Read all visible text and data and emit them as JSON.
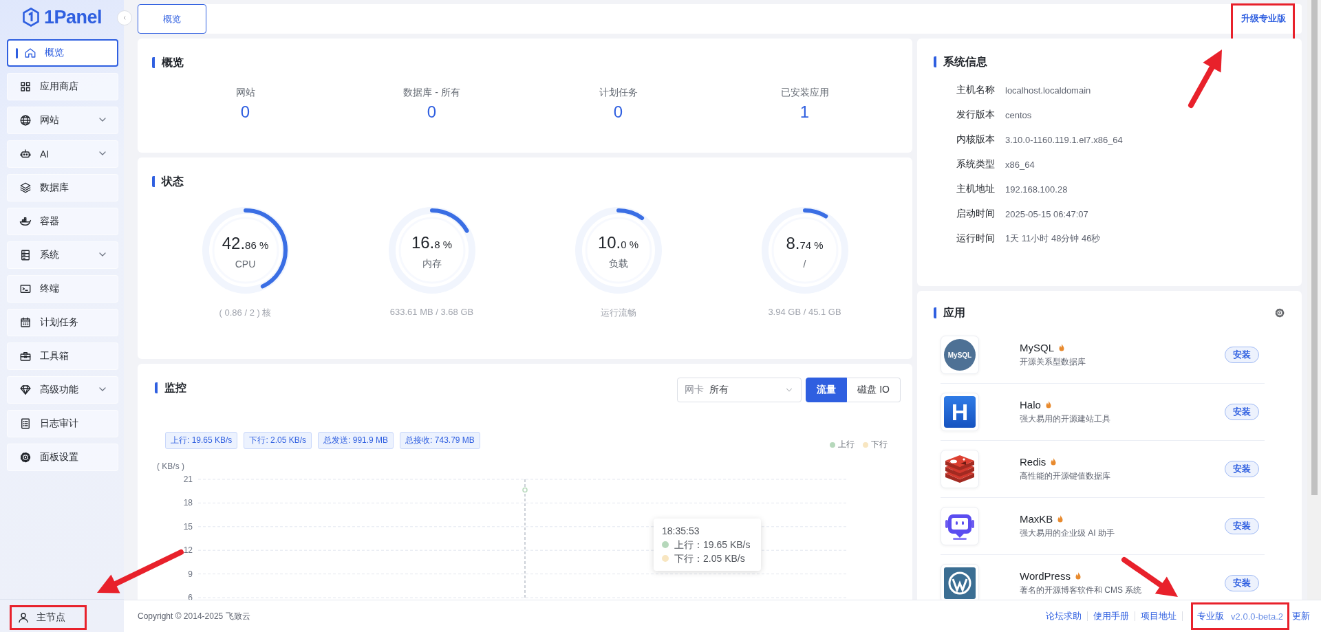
{
  "sidebar": {
    "logo": "1Panel",
    "items": [
      {
        "label": "概览",
        "kind": "item",
        "selected": true
      },
      {
        "label": "应用商店",
        "kind": "item",
        "selected": false
      },
      {
        "label": "网站",
        "kind": "menu",
        "selected": false
      },
      {
        "label": "AI",
        "kind": "menu",
        "selected": false
      },
      {
        "label": "数据库",
        "kind": "item",
        "selected": false
      },
      {
        "label": "容器",
        "kind": "item",
        "selected": false
      },
      {
        "label": "系统",
        "kind": "menu",
        "selected": false
      },
      {
        "label": "终端",
        "kind": "item",
        "selected": false
      },
      {
        "label": "计划任务",
        "kind": "item",
        "selected": false
      },
      {
        "label": "工具箱",
        "kind": "item",
        "selected": false
      },
      {
        "label": "高级功能",
        "kind": "menu",
        "selected": false
      },
      {
        "label": "日志审计",
        "kind": "item",
        "selected": false
      },
      {
        "label": "面板设置",
        "kind": "item",
        "selected": false
      }
    ],
    "node": "主节点"
  },
  "topbar": {
    "tabs": [
      {
        "label": "概览",
        "selected": true
      }
    ],
    "upgrade": "升级专业版"
  },
  "overview": {
    "title": "概览",
    "stats": [
      {
        "label": "网站",
        "value": "0"
      },
      {
        "label": "数据库 - 所有",
        "value": "0"
      },
      {
        "label": "计划任务",
        "value": "0"
      },
      {
        "label": "已安装应用",
        "value": "1"
      }
    ]
  },
  "status": {
    "title": "状态",
    "gauges": [
      {
        "value": "42.",
        "value_small": "86 %",
        "label": "CPU",
        "level": 0.4286,
        "detail": "( 0.86 / 2 ) 核"
      },
      {
        "value": "16.",
        "value_small": "8 %",
        "label": "内存",
        "level": 0.168,
        "detail": "633.61 MB / 3.68 GB"
      },
      {
        "value": "10.",
        "value_small": "0 %",
        "label": "负载",
        "level": 0.1,
        "detail": "运行流畅"
      },
      {
        "value": "8.",
        "value_small": "74 %",
        "label": "/",
        "level": 0.0874,
        "detail": "3.94 GB / 45.1 GB"
      }
    ]
  },
  "monitor": {
    "title": "监控",
    "select": {
      "label": "网卡",
      "value": "所有"
    },
    "toggles": [
      {
        "label": "流量",
        "selected": true
      },
      {
        "label": "磁盘 IO",
        "selected": false
      }
    ],
    "tags": [
      "上行: 19.65 KB/s",
      "下行: 2.05 KB/s",
      "总发送: 991.9 MB",
      "总接收: 743.79 MB"
    ],
    "chart_data": {
      "type": "line",
      "ylabel": "( KB/s )",
      "x": [
        "18:35:53"
      ],
      "ylim": [
        6,
        21
      ],
      "yticks": [
        6,
        9,
        12,
        15,
        18,
        21
      ],
      "grid": true,
      "ref_lines": [
        {
          "axis": "x",
          "value": "18:35:53"
        }
      ],
      "series": [
        {
          "name": "上行",
          "color": "#b6d8bb",
          "marker": "circle",
          "values": [
            19.65
          ]
        },
        {
          "name": "下行",
          "color": "#f8e6c1",
          "values": [
            null
          ]
        }
      ]
    },
    "tooltip": {
      "rows": [
        "上行：19.65 KB/s",
        "下行：2.05 KB/s"
      ]
    }
  },
  "system_info": {
    "title": "系统信息",
    "rows": [
      {
        "label": "主机名称",
        "value": "localhost.localdomain"
      },
      {
        "label": "发行版本",
        "value": "centos"
      },
      {
        "label": "内核版本",
        "value": "3.10.0-1160.119.1.el7.x86_64"
      },
      {
        "label": "系统类型",
        "value": "x86_64"
      },
      {
        "label": "主机地址",
        "value": "192.168.100.28"
      },
      {
        "label": "启动时间",
        "value": "2025-05-15 06:47:07"
      },
      {
        "label": "运行时间",
        "value": "1天 11小时 48分钟 46秒"
      }
    ]
  },
  "apps": {
    "title": "应用",
    "items": [
      {
        "kind": "mysql",
        "logo_text": "MySQL",
        "name": "MySQL",
        "hot": true,
        "description": "开源关系型数据库",
        "button": "安装"
      },
      {
        "kind": "halo",
        "logo_text": "H",
        "name": "Halo",
        "hot": true,
        "description": "强大易用的开源建站工具",
        "button": "安装"
      },
      {
        "kind": "redis",
        "name": "Redis",
        "hot": true,
        "description": "高性能的开源键值数据库",
        "button": "安装"
      },
      {
        "kind": "maxkb",
        "name": "MaxKB",
        "hot": true,
        "description": "强大易用的企业级 AI 助手",
        "button": "安装"
      },
      {
        "kind": "wordpress",
        "name": "WordPress",
        "hot": true,
        "description": "著名的开源博客软件和 CMS 系统",
        "button": "安装"
      }
    ]
  },
  "footer": {
    "copyright": "Copyright © 2014-2025 飞致云",
    "links": [
      "论坛求助",
      "使用手册",
      "项目地址"
    ],
    "edition": "专业版",
    "version": "v2.0.0-beta.2",
    "update": "更新"
  }
}
